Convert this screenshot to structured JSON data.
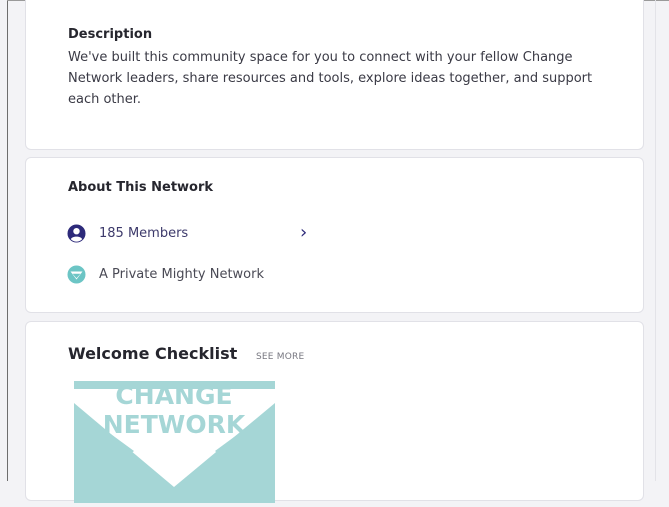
{
  "description": {
    "title": "Description",
    "text": "We've built this community space for you to connect with your fellow Change Network leaders, share resources and tools, explore ideas together, and support each other."
  },
  "about": {
    "title": "About This Network",
    "members_label": "185 Members",
    "chevron": "›",
    "private_label": "A Private Mighty Network"
  },
  "checklist": {
    "title": "Welcome Checklist",
    "see_more": "SEE MORE",
    "logo_line1": "CHANGE",
    "logo_line2": "NETWORK"
  },
  "colors": {
    "accent": "#2d2a7a",
    "logo_teal": "#a5d6d6",
    "private_icon": "#6cc5c5"
  },
  "icons": {
    "members": "user-circle-icon",
    "private": "mighty-network-icon",
    "chevron": "chevron-right-icon"
  }
}
